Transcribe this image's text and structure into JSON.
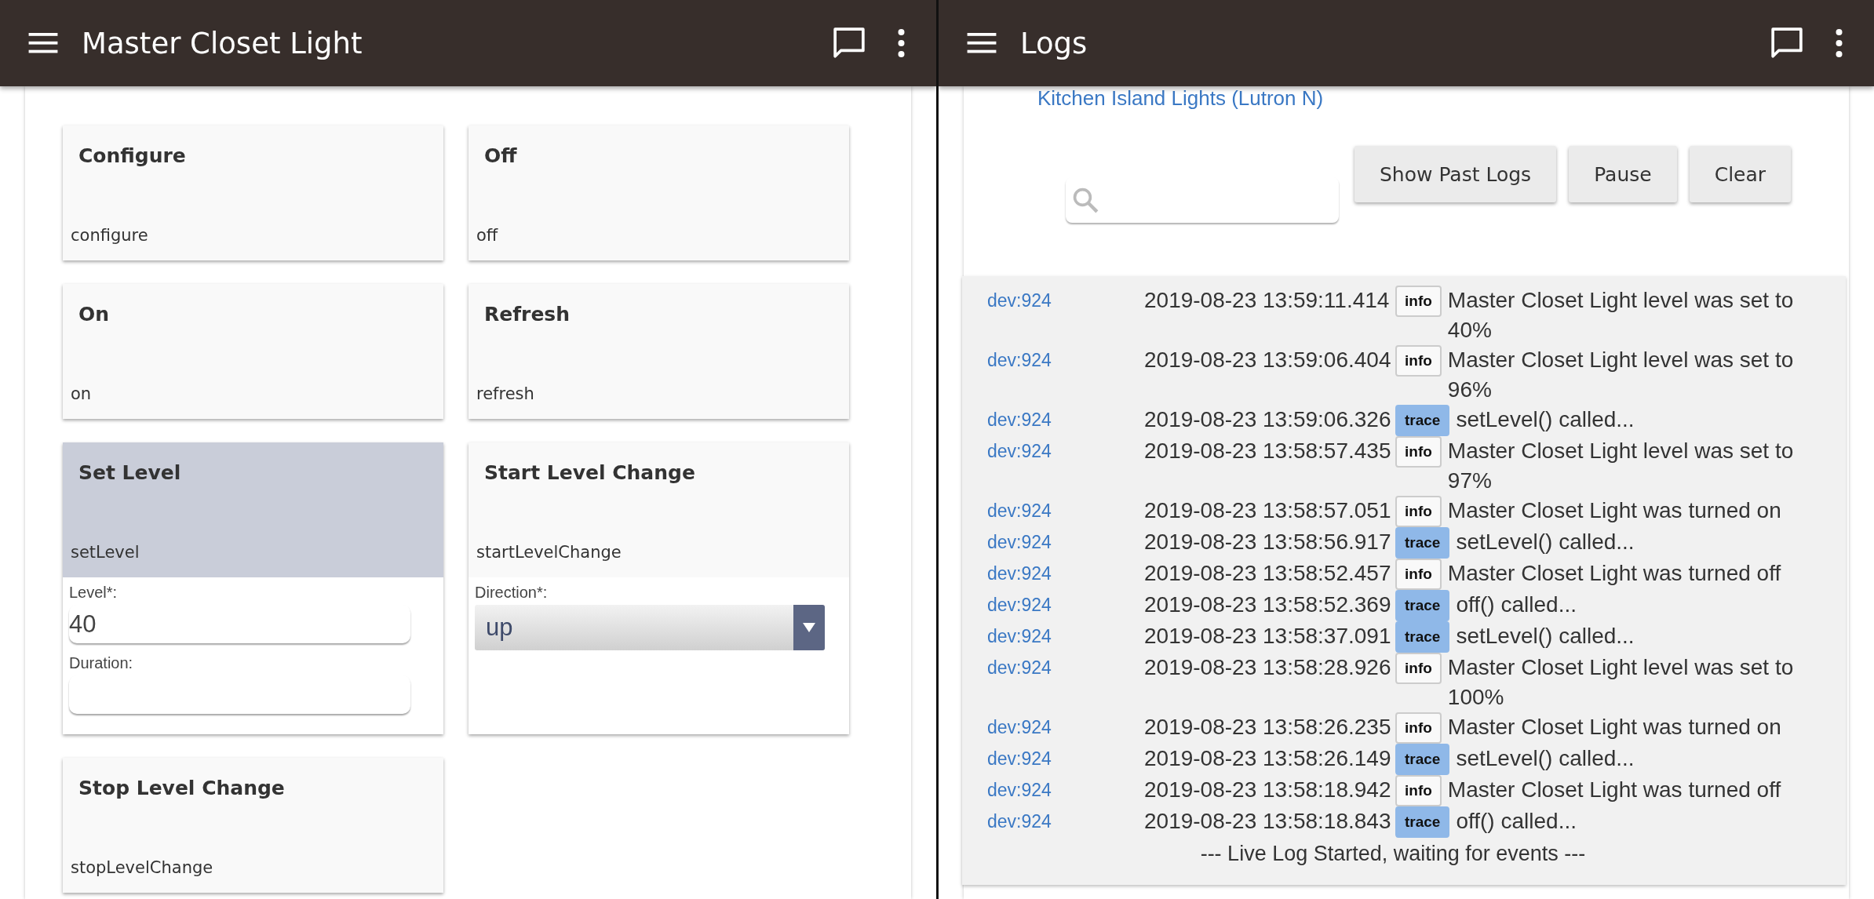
{
  "left_pane": {
    "app_bar": {
      "title": "Master Closet Light"
    },
    "commands": [
      {
        "title": "Configure",
        "name": "configure",
        "selected": false
      },
      {
        "title": "Off",
        "name": "off",
        "selected": false
      },
      {
        "title": "On",
        "name": "on",
        "selected": false
      },
      {
        "title": "Refresh",
        "name": "refresh",
        "selected": false
      },
      {
        "title": "Set Level",
        "name": "setLevel",
        "selected": true,
        "params": [
          {
            "kind": "text",
            "label": "Level*:",
            "value": "40"
          },
          {
            "kind": "text",
            "label": "Duration:"
          }
        ]
      },
      {
        "title": "Start Level Change",
        "name": "startLevelChange",
        "selected": false,
        "params": [
          {
            "kind": "select",
            "label": "Direction*:",
            "value": "up"
          }
        ]
      },
      {
        "title": "Stop Level Change",
        "name": "stopLevelChange",
        "selected": false
      }
    ]
  },
  "right_pane": {
    "app_bar": {
      "title": "Logs"
    },
    "device_link": "Kitchen Island Lights (Lutron N)",
    "buttons": [
      "Show Past Logs",
      "Pause",
      "Clear"
    ],
    "log_entries": [
      {
        "source": "dev:924",
        "time": "2019-08-23 13:59:11.414",
        "kind": "info",
        "message": "Master Closet Light level was set to 40%"
      },
      {
        "source": "dev:924",
        "time": "2019-08-23 13:59:06.404",
        "kind": "info",
        "message": "Master Closet Light level was set to 96%"
      },
      {
        "source": "dev:924",
        "time": "2019-08-23 13:59:06.326",
        "kind": "trace",
        "message": "setLevel() called..."
      },
      {
        "source": "dev:924",
        "time": "2019-08-23 13:58:57.435",
        "kind": "info",
        "message": "Master Closet Light level was set to 97%"
      },
      {
        "source": "dev:924",
        "time": "2019-08-23 13:58:57.051",
        "kind": "info",
        "message": "Master Closet Light was turned on"
      },
      {
        "source": "dev:924",
        "time": "2019-08-23 13:58:56.917",
        "kind": "trace",
        "message": "setLevel() called..."
      },
      {
        "source": "dev:924",
        "time": "2019-08-23 13:58:52.457",
        "kind": "info",
        "message": "Master Closet Light was turned off"
      },
      {
        "source": "dev:924",
        "time": "2019-08-23 13:58:52.369",
        "kind": "trace",
        "message": "off() called..."
      },
      {
        "source": "dev:924",
        "time": "2019-08-23 13:58:37.091",
        "kind": "trace",
        "message": "setLevel() called..."
      },
      {
        "source": "dev:924",
        "time": "2019-08-23 13:58:28.926",
        "kind": "info",
        "message": "Master Closet Light level was set to 100%"
      },
      {
        "source": "dev:924",
        "time": "2019-08-23 13:58:26.235",
        "kind": "info",
        "message": "Master Closet Light was turned on"
      },
      {
        "source": "dev:924",
        "time": "2019-08-23 13:58:26.149",
        "kind": "trace",
        "message": "setLevel() called..."
      },
      {
        "source": "dev:924",
        "time": "2019-08-23 13:58:18.942",
        "kind": "info",
        "message": "Master Closet Light was turned off"
      },
      {
        "source": "dev:924",
        "time": "2019-08-23 13:58:18.843",
        "kind": "trace",
        "message": "off() called..."
      }
    ],
    "status_line": "--- Live Log Started, waiting for events ---"
  }
}
